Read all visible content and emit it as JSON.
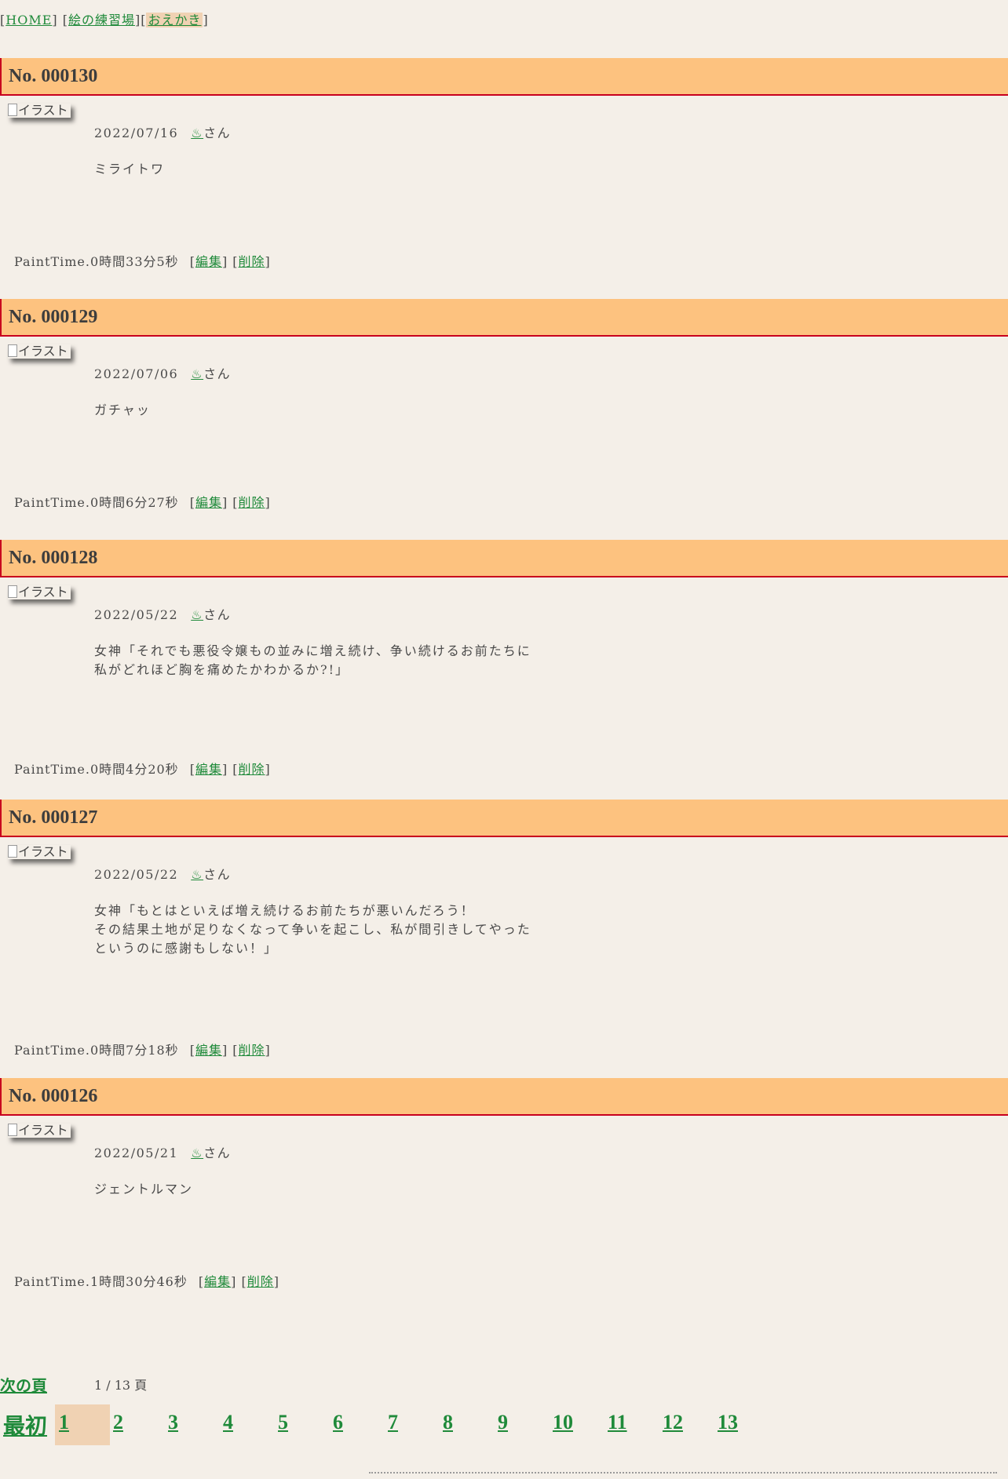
{
  "nav": {
    "home": "HOME",
    "practice": "絵の練習場",
    "oekaki": "おえかき"
  },
  "thumb_alt": "イラスト",
  "posts": [
    {
      "no": "No. 000130",
      "date": "2022/07/16",
      "user": "♨",
      "san": "さん",
      "lines": [
        "ミライトワ"
      ],
      "painttime": "PaintTime.0時間33分5秒",
      "edit": "編集",
      "del": "削除"
    },
    {
      "no": "No. 000129",
      "date": "2022/07/06",
      "user": "♨",
      "san": "さん",
      "lines": [
        "ガチャッ"
      ],
      "painttime": "PaintTime.0時間6分27秒",
      "edit": "編集",
      "del": "削除"
    },
    {
      "no": "No. 000128",
      "date": "2022/05/22",
      "user": "♨",
      "san": "さん",
      "lines": [
        "女神「それでも悪役令嬢もの並みに増え続け、争い続けるお前たちに",
        "私がどれほど胸を痛めたかわかるか?!」"
      ],
      "painttime": "PaintTime.0時間4分20秒",
      "edit": "編集",
      "del": "削除"
    },
    {
      "no": "No. 000127",
      "date": "2022/05/22",
      "user": "♨",
      "san": "さん",
      "lines": [
        "女神「もとはといえば増え続けるお前たちが悪いんだろう！",
        "その結果土地が足りなくなって争いを起こし、私が間引きしてやった",
        "というのに感謝もしない！」"
      ],
      "painttime": "PaintTime.0時間7分18秒",
      "edit": "編集",
      "del": "削除"
    },
    {
      "no": "No. 000126",
      "date": "2022/05/21",
      "user": "♨",
      "san": "さん",
      "lines": [
        "ジェントルマン"
      ],
      "painttime": "PaintTime.1時間30分46秒",
      "edit": "編集",
      "del": "削除"
    }
  ],
  "pager": {
    "next": "次の頁",
    "count": "1 / 13 頁",
    "first": "最初",
    "pages": [
      "1",
      "2",
      "3",
      "4",
      "5",
      "6",
      "7",
      "8",
      "9",
      "10",
      "11",
      "12",
      "13"
    ],
    "current": "1"
  }
}
